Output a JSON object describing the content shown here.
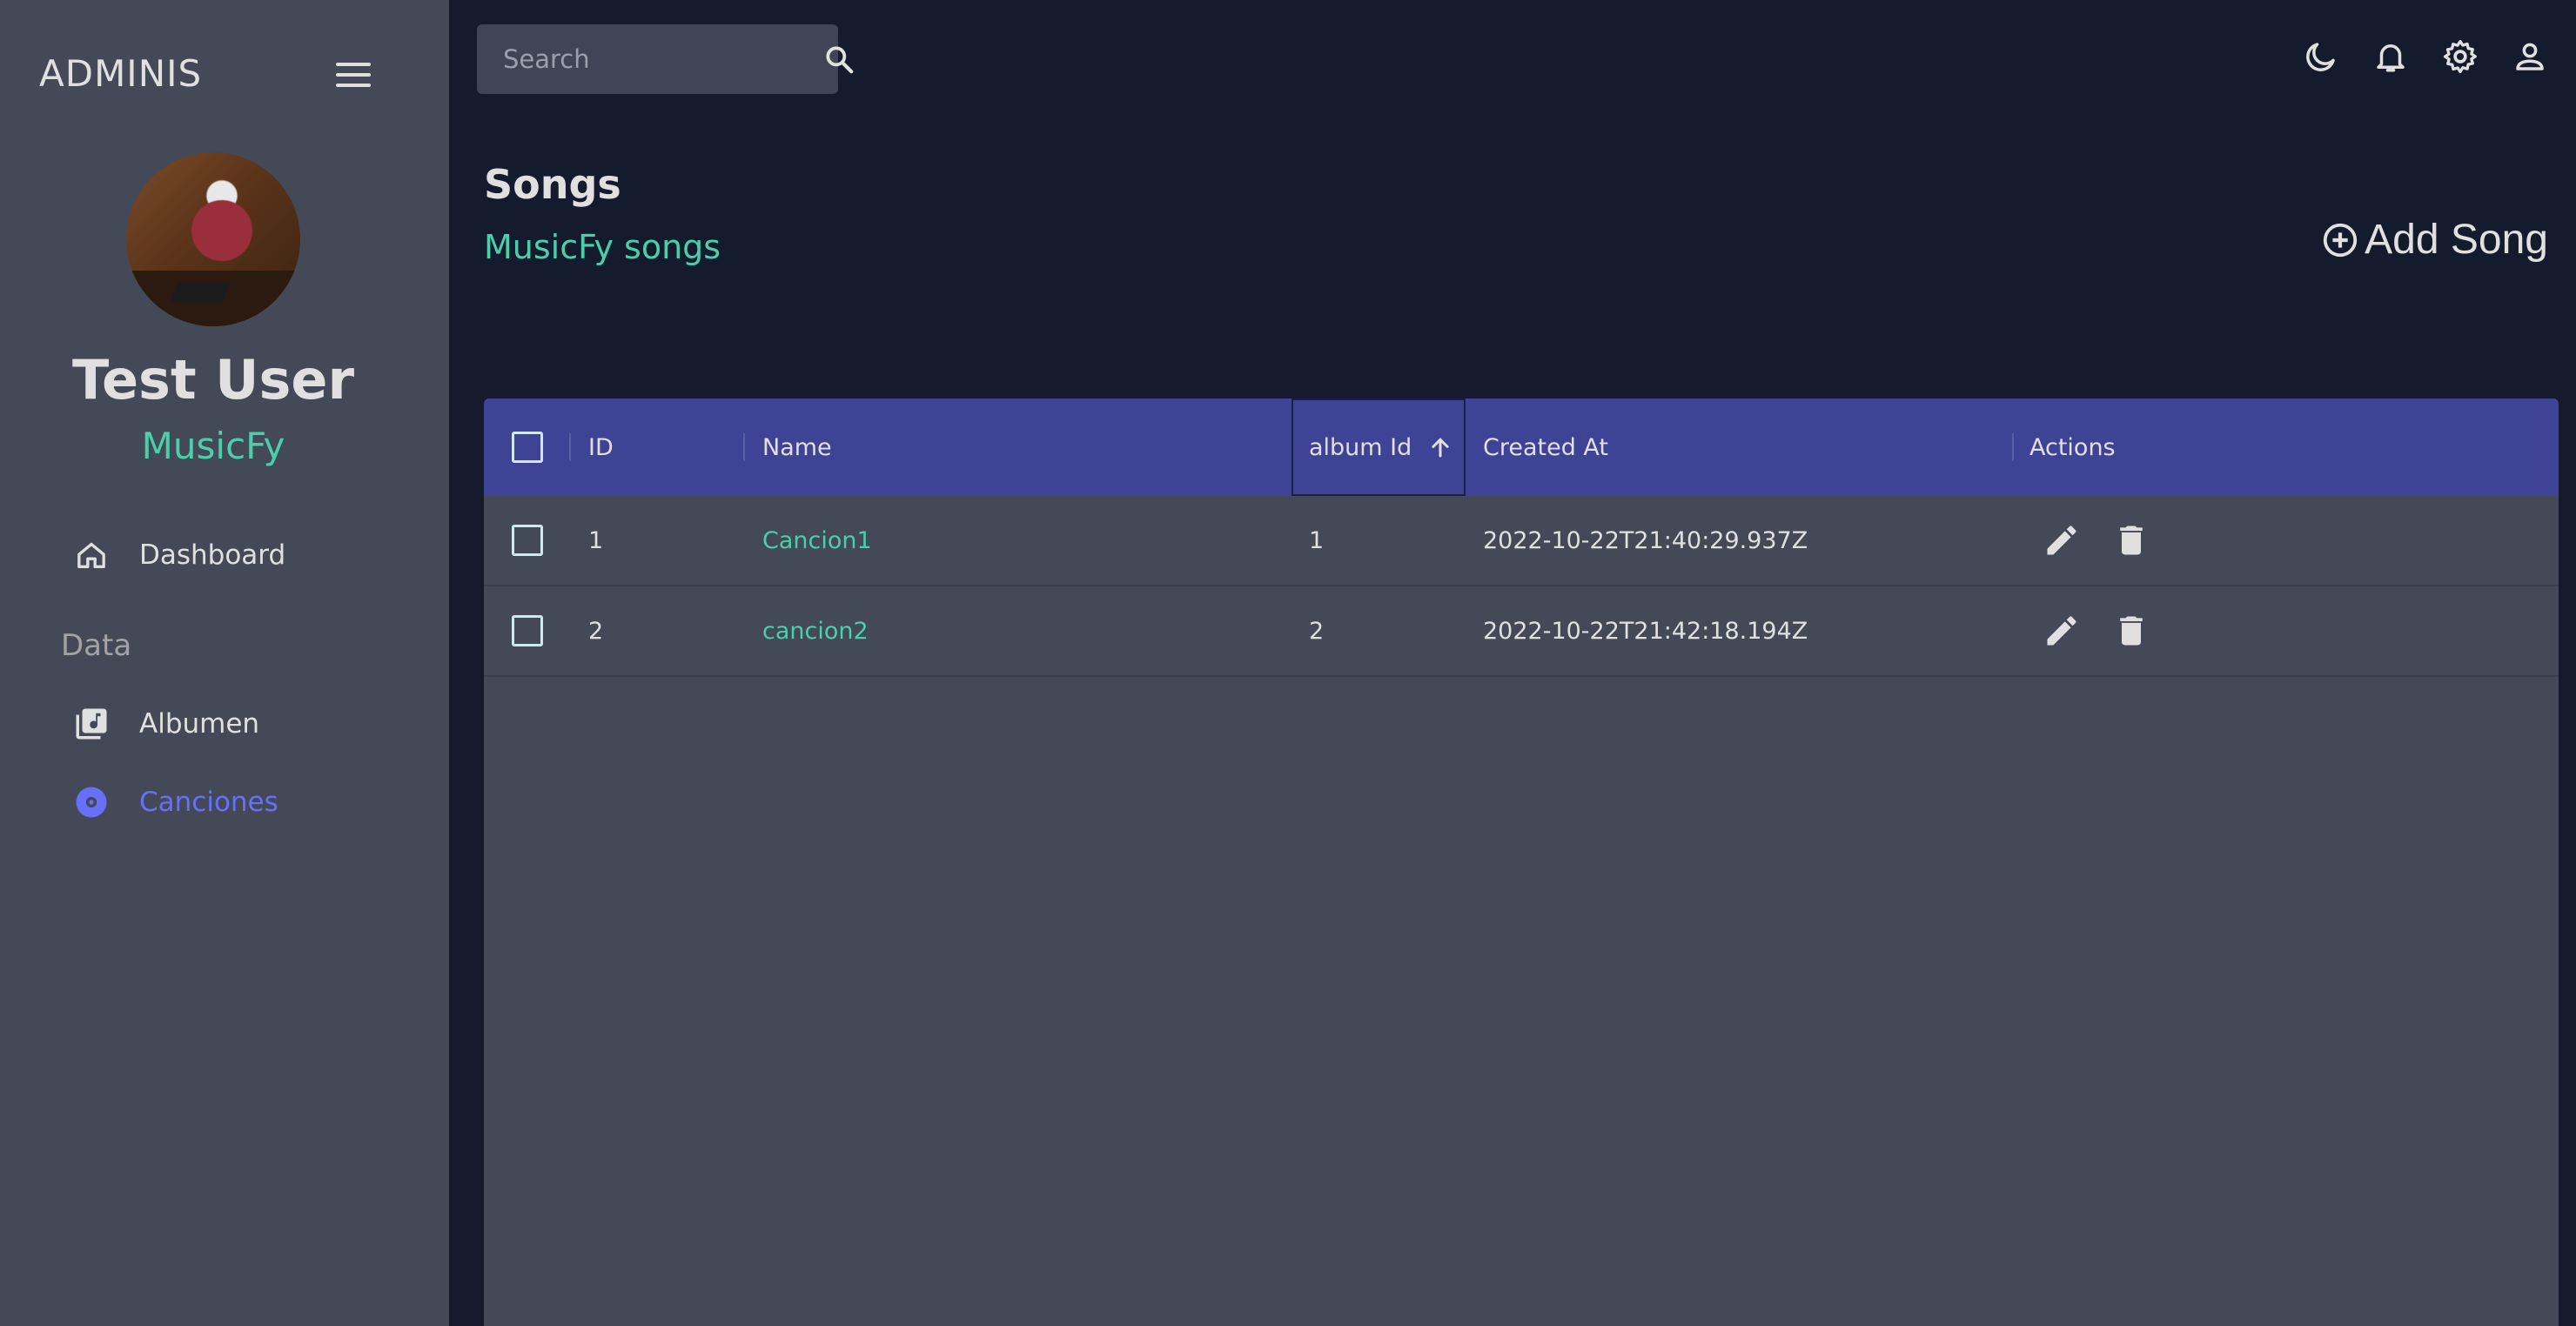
{
  "sidebar": {
    "brand": "ADMINIS",
    "user_name": "Test User",
    "user_org": "MusicFy",
    "section_data": "Data",
    "items": [
      {
        "label": "Dashboard",
        "icon": "home-icon"
      },
      {
        "label": "Albumen",
        "icon": "library-music-icon"
      },
      {
        "label": "Canciones",
        "icon": "album-icon",
        "active": true
      }
    ]
  },
  "topbar": {
    "search_placeholder": "Search",
    "icons": [
      "dark-mode-icon",
      "notifications-icon",
      "settings-icon",
      "person-icon"
    ]
  },
  "header": {
    "title": "Songs",
    "subtitle": "MusicFy songs",
    "add_button": "Add Song"
  },
  "grid": {
    "columns": [
      "ID",
      "Name",
      "album Id",
      "Created At",
      "Actions"
    ],
    "sorted_column": "album Id",
    "sort_direction": "ascending",
    "rows": [
      {
        "id": "1",
        "name": "Cancion1",
        "album_id": "1",
        "created_at": "2022-10-22T21:40:29.937Z"
      },
      {
        "id": "2",
        "name": "cancion2",
        "album_id": "2",
        "created_at": "2022-10-22T21:42:18.194Z"
      }
    ]
  },
  "colors": {
    "background": "#141b2d",
    "sidebar": "#434957",
    "header_bar": "#3e4396",
    "accent_green": "#4cceac",
    "accent_purple": "#6870fa"
  }
}
